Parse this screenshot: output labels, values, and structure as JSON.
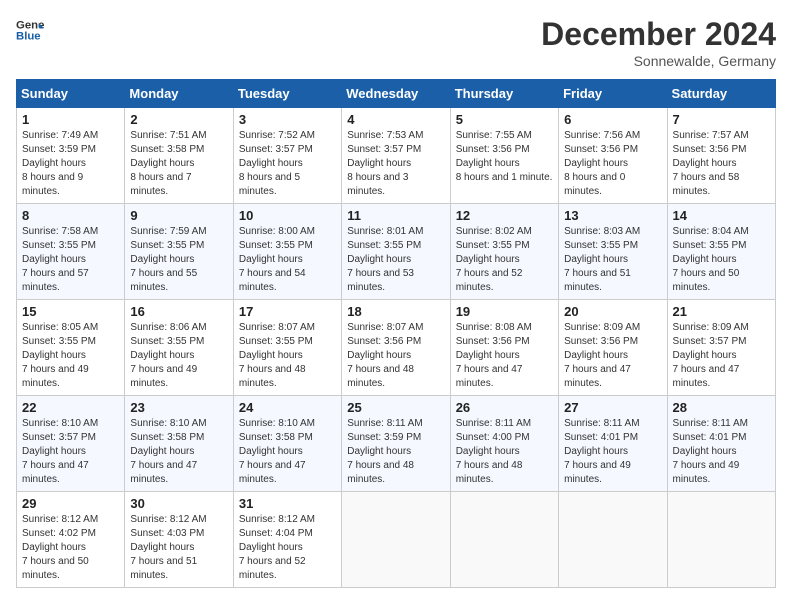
{
  "header": {
    "logo_line1": "General",
    "logo_line2": "Blue",
    "title": "December 2024",
    "subtitle": "Sonnewalde, Germany"
  },
  "weekdays": [
    "Sunday",
    "Monday",
    "Tuesday",
    "Wednesday",
    "Thursday",
    "Friday",
    "Saturday"
  ],
  "weeks": [
    [
      {
        "day": "1",
        "sunrise": "7:49 AM",
        "sunset": "3:59 PM",
        "daylight": "8 hours and 9 minutes."
      },
      {
        "day": "2",
        "sunrise": "7:51 AM",
        "sunset": "3:58 PM",
        "daylight": "8 hours and 7 minutes."
      },
      {
        "day": "3",
        "sunrise": "7:52 AM",
        "sunset": "3:57 PM",
        "daylight": "8 hours and 5 minutes."
      },
      {
        "day": "4",
        "sunrise": "7:53 AM",
        "sunset": "3:57 PM",
        "daylight": "8 hours and 3 minutes."
      },
      {
        "day": "5",
        "sunrise": "7:55 AM",
        "sunset": "3:56 PM",
        "daylight": "8 hours and 1 minute."
      },
      {
        "day": "6",
        "sunrise": "7:56 AM",
        "sunset": "3:56 PM",
        "daylight": "8 hours and 0 minutes."
      },
      {
        "day": "7",
        "sunrise": "7:57 AM",
        "sunset": "3:56 PM",
        "daylight": "7 hours and 58 minutes."
      }
    ],
    [
      {
        "day": "8",
        "sunrise": "7:58 AM",
        "sunset": "3:55 PM",
        "daylight": "7 hours and 57 minutes."
      },
      {
        "day": "9",
        "sunrise": "7:59 AM",
        "sunset": "3:55 PM",
        "daylight": "7 hours and 55 minutes."
      },
      {
        "day": "10",
        "sunrise": "8:00 AM",
        "sunset": "3:55 PM",
        "daylight": "7 hours and 54 minutes."
      },
      {
        "day": "11",
        "sunrise": "8:01 AM",
        "sunset": "3:55 PM",
        "daylight": "7 hours and 53 minutes."
      },
      {
        "day": "12",
        "sunrise": "8:02 AM",
        "sunset": "3:55 PM",
        "daylight": "7 hours and 52 minutes."
      },
      {
        "day": "13",
        "sunrise": "8:03 AM",
        "sunset": "3:55 PM",
        "daylight": "7 hours and 51 minutes."
      },
      {
        "day": "14",
        "sunrise": "8:04 AM",
        "sunset": "3:55 PM",
        "daylight": "7 hours and 50 minutes."
      }
    ],
    [
      {
        "day": "15",
        "sunrise": "8:05 AM",
        "sunset": "3:55 PM",
        "daylight": "7 hours and 49 minutes."
      },
      {
        "day": "16",
        "sunrise": "8:06 AM",
        "sunset": "3:55 PM",
        "daylight": "7 hours and 49 minutes."
      },
      {
        "day": "17",
        "sunrise": "8:07 AM",
        "sunset": "3:55 PM",
        "daylight": "7 hours and 48 minutes."
      },
      {
        "day": "18",
        "sunrise": "8:07 AM",
        "sunset": "3:56 PM",
        "daylight": "7 hours and 48 minutes."
      },
      {
        "day": "19",
        "sunrise": "8:08 AM",
        "sunset": "3:56 PM",
        "daylight": "7 hours and 47 minutes."
      },
      {
        "day": "20",
        "sunrise": "8:09 AM",
        "sunset": "3:56 PM",
        "daylight": "7 hours and 47 minutes."
      },
      {
        "day": "21",
        "sunrise": "8:09 AM",
        "sunset": "3:57 PM",
        "daylight": "7 hours and 47 minutes."
      }
    ],
    [
      {
        "day": "22",
        "sunrise": "8:10 AM",
        "sunset": "3:57 PM",
        "daylight": "7 hours and 47 minutes."
      },
      {
        "day": "23",
        "sunrise": "8:10 AM",
        "sunset": "3:58 PM",
        "daylight": "7 hours and 47 minutes."
      },
      {
        "day": "24",
        "sunrise": "8:10 AM",
        "sunset": "3:58 PM",
        "daylight": "7 hours and 47 minutes."
      },
      {
        "day": "25",
        "sunrise": "8:11 AM",
        "sunset": "3:59 PM",
        "daylight": "7 hours and 48 minutes."
      },
      {
        "day": "26",
        "sunrise": "8:11 AM",
        "sunset": "4:00 PM",
        "daylight": "7 hours and 48 minutes."
      },
      {
        "day": "27",
        "sunrise": "8:11 AM",
        "sunset": "4:01 PM",
        "daylight": "7 hours and 49 minutes."
      },
      {
        "day": "28",
        "sunrise": "8:11 AM",
        "sunset": "4:01 PM",
        "daylight": "7 hours and 49 minutes."
      }
    ],
    [
      {
        "day": "29",
        "sunrise": "8:12 AM",
        "sunset": "4:02 PM",
        "daylight": "7 hours and 50 minutes."
      },
      {
        "day": "30",
        "sunrise": "8:12 AM",
        "sunset": "4:03 PM",
        "daylight": "7 hours and 51 minutes."
      },
      {
        "day": "31",
        "sunrise": "8:12 AM",
        "sunset": "4:04 PM",
        "daylight": "7 hours and 52 minutes."
      },
      null,
      null,
      null,
      null
    ]
  ]
}
